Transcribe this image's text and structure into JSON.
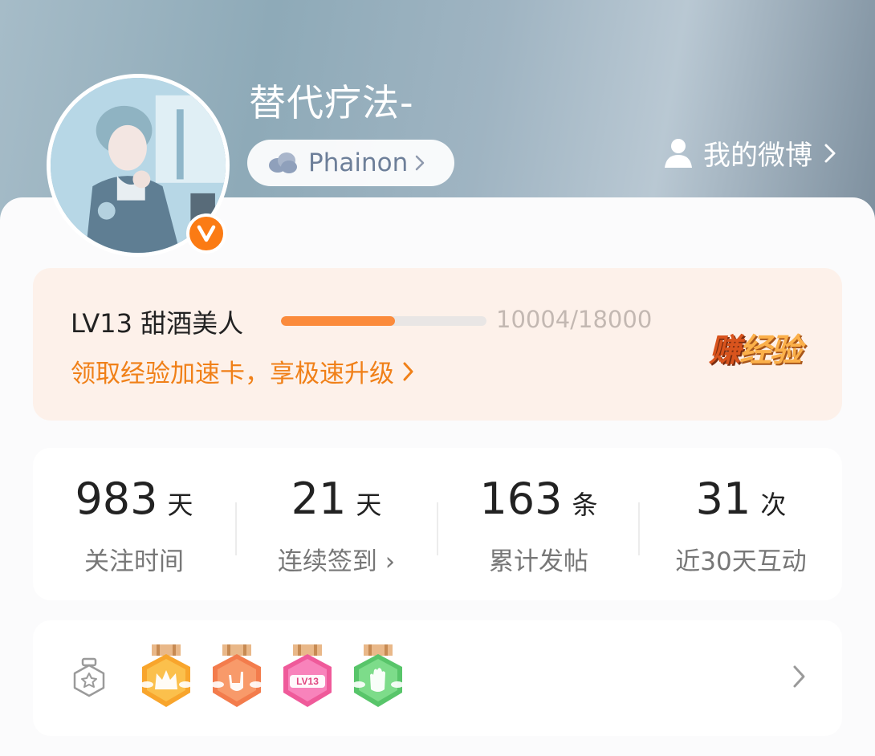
{
  "profile": {
    "username": "替代疗法-",
    "tag_label": "Phainon",
    "my_weibo_label": "我的微博",
    "verified_mark": "V"
  },
  "experience": {
    "level_label": "LV13 甜酒美人",
    "progress_text": "10004/18000",
    "progress_fraction": 0.556,
    "promo_text": "领取经验加速卡，享极速升级",
    "earn_part1": "赚",
    "earn_part2": "经验"
  },
  "stats": [
    {
      "value": "983",
      "unit": "天",
      "label": "关注时间"
    },
    {
      "value": "21",
      "unit": "天",
      "label": "连续签到 ›"
    },
    {
      "value": "163",
      "unit": "条",
      "label": "累计发帖"
    },
    {
      "value": "31",
      "unit": "次",
      "label": "近30天互动"
    }
  ],
  "badges": [
    {
      "icon": "crown-badge-icon",
      "color": "#f8a52c",
      "text": ""
    },
    {
      "icon": "rock-hand-badge-icon",
      "color": "#f37c4c",
      "text": ""
    },
    {
      "icon": "lv13-badge-icon",
      "color": "#ef5a9a",
      "text": "LV13"
    },
    {
      "icon": "hand-badge-icon",
      "color": "#58c56a",
      "text": ""
    }
  ],
  "colors": {
    "accent_orange": "#f08018",
    "progress_fill": "#fb8b3c",
    "verified_badge": "#fb7b14"
  }
}
